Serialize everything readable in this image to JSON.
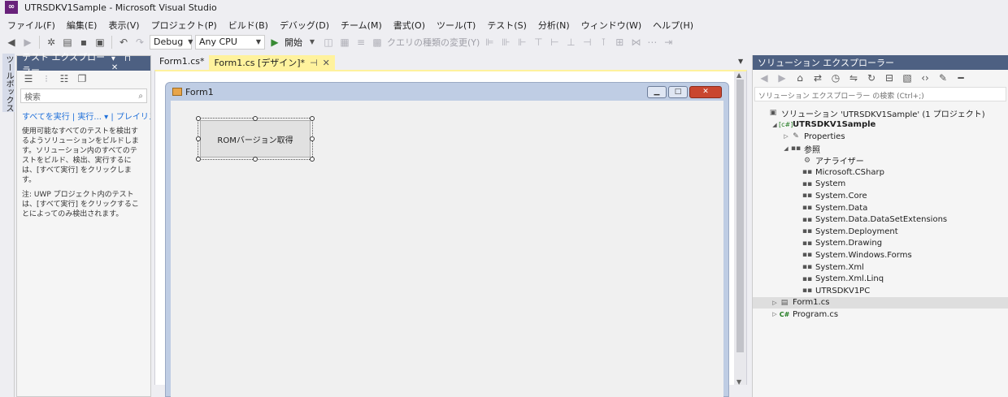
{
  "window": {
    "title": "UTRSDKV1Sample - Microsoft Visual Studio"
  },
  "menu": [
    "ファイル(F)",
    "編集(E)",
    "表示(V)",
    "プロジェクト(P)",
    "ビルド(B)",
    "デバッグ(D)",
    "チーム(M)",
    "書式(O)",
    "ツール(T)",
    "テスト(S)",
    "分析(N)",
    "ウィンドウ(W)",
    "ヘルプ(H)"
  ],
  "toolbar": {
    "config": "Debug",
    "platform": "Any CPU",
    "start_label": "開始",
    "query_label": "クエリの種類の変更(Y)"
  },
  "toolbox": {
    "label": "ツールボックス"
  },
  "test_explorer": {
    "title": "テスト エクスプローラー",
    "search_placeholder": "検索",
    "links": "すべてを実行 | 実行... ▾ | プレイリスト",
    "para1": "使用可能なすべてのテストを検出するようソリューションをビルドします。ソリューション内のすべてのテストをビルド、検出、実行するには、[すべて実行] をクリックします。",
    "para2": "注: UWP プロジェクト内のテストは、[すべて実行] をクリックすることによってのみ検出されます。"
  },
  "tabs": [
    {
      "label": "Form1.cs*",
      "active": false
    },
    {
      "label": "Form1.cs [デザイン]*",
      "active": true
    }
  ],
  "form": {
    "title": "Form1",
    "button_label": "ROMバージョン取得"
  },
  "solution_explorer": {
    "title": "ソリューション エクスプローラー",
    "search_placeholder": "ソリューション エクスプローラー の検索 (Ctrl+;)",
    "items": [
      {
        "label": "ソリューション 'UTRSDKV1Sample' (1 プロジェクト)",
        "level": 0,
        "arrow": "",
        "icon": "solution"
      },
      {
        "label": "UTRSDKV1Sample",
        "level": 1,
        "arrow": "open",
        "icon": "project",
        "bold": true
      },
      {
        "label": "Properties",
        "level": 2,
        "arrow": "closed",
        "icon": "wrench"
      },
      {
        "label": "参照",
        "level": 2,
        "arrow": "open",
        "icon": "reference"
      },
      {
        "label": "アナライザー",
        "level": 3,
        "arrow": "",
        "icon": "analyzer"
      },
      {
        "label": "Microsoft.CSharp",
        "level": 3,
        "arrow": "",
        "icon": "reference"
      },
      {
        "label": "System",
        "level": 3,
        "arrow": "",
        "icon": "reference"
      },
      {
        "label": "System.Core",
        "level": 3,
        "arrow": "",
        "icon": "reference"
      },
      {
        "label": "System.Data",
        "level": 3,
        "arrow": "",
        "icon": "reference"
      },
      {
        "label": "System.Data.DataSetExtensions",
        "level": 3,
        "arrow": "",
        "icon": "reference"
      },
      {
        "label": "System.Deployment",
        "level": 3,
        "arrow": "",
        "icon": "reference"
      },
      {
        "label": "System.Drawing",
        "level": 3,
        "arrow": "",
        "icon": "reference"
      },
      {
        "label": "System.Windows.Forms",
        "level": 3,
        "arrow": "",
        "icon": "reference"
      },
      {
        "label": "System.Xml",
        "level": 3,
        "arrow": "",
        "icon": "reference"
      },
      {
        "label": "System.Xml.Linq",
        "level": 3,
        "arrow": "",
        "icon": "reference"
      },
      {
        "label": "UTRSDKV1PC",
        "level": 3,
        "arrow": "",
        "icon": "reference"
      },
      {
        "label": "Form1.cs",
        "level": 1,
        "arrow": "closed",
        "icon": "form",
        "selected": true
      },
      {
        "label": "Program.cs",
        "level": 1,
        "arrow": "closed",
        "icon": "csharp"
      }
    ]
  }
}
